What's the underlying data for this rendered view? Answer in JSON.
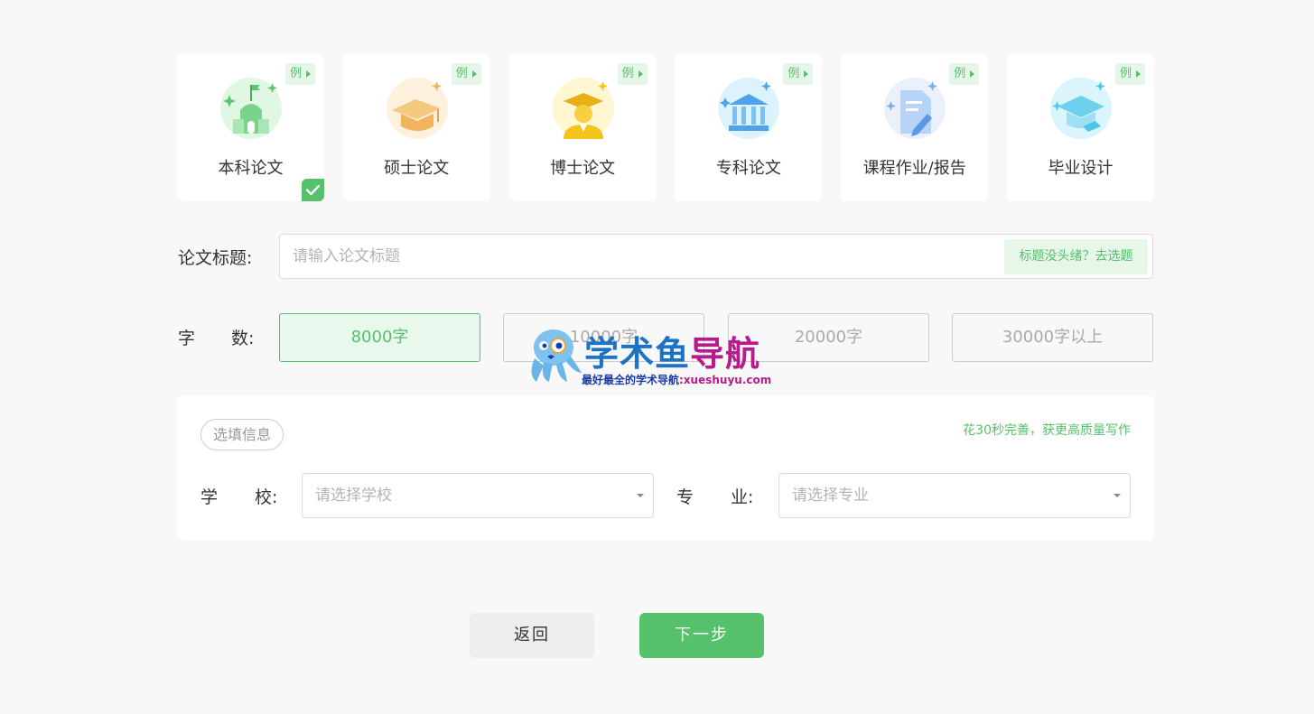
{
  "example_label": "例",
  "paper_types": [
    {
      "label": "本科论文",
      "icon": "school-building-icon",
      "selected": true,
      "tint": "#dff7e3",
      "color": "#5cc66f"
    },
    {
      "label": "硕士论文",
      "icon": "graduation-cap-icon",
      "selected": false,
      "tint": "#fdf1de",
      "color": "#f2b35c"
    },
    {
      "label": "博士论文",
      "icon": "doctor-graduate-icon",
      "selected": false,
      "tint": "#fff6d2",
      "color": "#f4c31c"
    },
    {
      "label": "专科论文",
      "icon": "institution-building-icon",
      "selected": false,
      "tint": "#dcf3fd",
      "color": "#4ea3e8"
    },
    {
      "label": "课程作业/报告",
      "icon": "document-pen-icon",
      "selected": false,
      "tint": "#eaf1fc",
      "color": "#7fb0ee"
    },
    {
      "label": "毕业设计",
      "icon": "design-cap-icon",
      "selected": false,
      "tint": "#dbf5fd",
      "color": "#4ec6e8"
    }
  ],
  "title_field": {
    "label": "论文标题:",
    "placeholder": "请输入论文标题",
    "value": "",
    "helper_button": "标题没头绪？去选题"
  },
  "word_count": {
    "label_1": "字",
    "label_2": "数:",
    "options": [
      "8000字",
      "10000字",
      "20000字",
      "30000字以上"
    ],
    "selected_index": 0
  },
  "optional": {
    "tag": "选填信息",
    "tip": "花30秒完善，获更高质量写作",
    "school_label_1": "学",
    "school_label_2": "校:",
    "school_placeholder": "请选择学校",
    "major_label_1": "专",
    "major_label_2": "业:",
    "major_placeholder": "请选择专业"
  },
  "buttons": {
    "back": "返回",
    "next": "下一步"
  },
  "watermark": {
    "title_a": "学术鱼",
    "title_b": "导航",
    "subtitle_a": "最好最全的学术导航",
    "subtitle_b": ":xueshuyu.com"
  },
  "colors": {
    "accent": "#55c16c",
    "accent_bg": "#e6f6e9"
  }
}
